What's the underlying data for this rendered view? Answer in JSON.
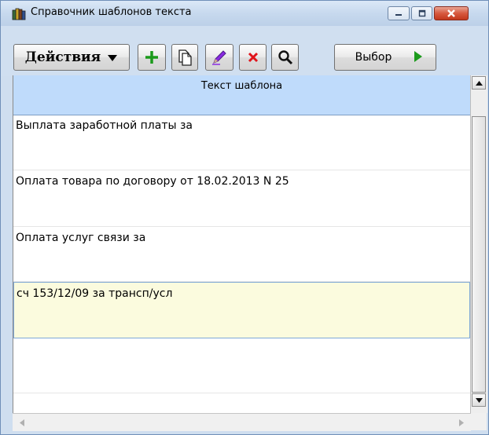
{
  "window": {
    "title": "Справочник шаблонов текста",
    "controls": {
      "minimize_icon": "minimize-icon",
      "maximize_icon": "maximize-icon",
      "close_icon": "close-icon"
    }
  },
  "toolbar": {
    "actions_label": "Действия",
    "select_label": "Выбор",
    "icons": [
      "add-icon",
      "copy-icon",
      "edit-pencil-icon",
      "delete-icon",
      "search-icon",
      "play-arrow-icon"
    ]
  },
  "grid": {
    "column_header": "Текст шаблона",
    "rows": [
      {
        "text": "Выплата заработной платы за"
      },
      {
        "text": "Оплата товара по договору от 18.02.2013 N 25"
      },
      {
        "text": "Оплата услуг связи за"
      },
      {
        "text": "сч 153/12/09 за трансп/усл"
      }
    ],
    "selected_row_index": 3
  },
  "colors": {
    "header_bg": "#bfdbfb",
    "selected_row_bg": "#fbfbde",
    "add_green": "#1b9a1b",
    "delete_red": "#e0141b",
    "edit_purple": "#8a2be2"
  }
}
